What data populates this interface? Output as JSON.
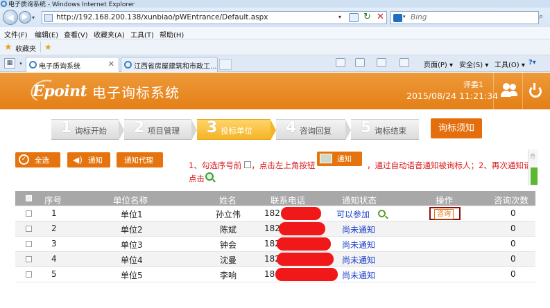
{
  "browser": {
    "window_title": "电子质询系统 - Windows Internet Explorer",
    "url": "http://192.168.200.138/xunbiao/pWEntrance/Default.aspx",
    "search_placeholder": "Bing",
    "menu": [
      "文件(F)",
      "编辑(E)",
      "查看(V)",
      "收藏夹(A)",
      "工具(T)",
      "帮助(H)"
    ],
    "favorites_label": "收藏夹",
    "tabs": [
      {
        "title": "电子质询系统",
        "active": true
      },
      {
        "title": "江西省房屋建筑和市政工...",
        "active": false
      }
    ],
    "command_bar": [
      "页面(P) ▾",
      "安全(S) ▾",
      "工具(O) ▾"
    ]
  },
  "app": {
    "logo": "Epoint",
    "title": "电子询标系统",
    "user": "评委1",
    "datetime": "2015/08/24 11:21:34",
    "accent_color": "#e5740f"
  },
  "steps": [
    {
      "num": "1",
      "label": "询标开始",
      "active": false
    },
    {
      "num": "2",
      "label": "项目管理",
      "active": false
    },
    {
      "num": "3",
      "label": "投标单位",
      "active": true
    },
    {
      "num": "4",
      "label": "咨询回复",
      "active": false
    },
    {
      "num": "5",
      "label": "询标结束",
      "active": false
    }
  ],
  "notice_button": "询标须知",
  "toolbar": {
    "select_all": "全选",
    "notify": "通知",
    "notify_agent": "通知代理"
  },
  "instruction": {
    "part1": "1、勾选序号前",
    "part2": "，点击左上角按钮",
    "button": "通知",
    "part3": "，通过自动语音通知被询标人；2、再次通知请",
    "line2": "点击"
  },
  "table": {
    "headers": [
      "序号",
      "单位名称",
      "姓名",
      "联系电话",
      "通知状态",
      "操作",
      "咨询次数"
    ],
    "rows": [
      {
        "no": "1",
        "unit": "单位1",
        "name": "孙立伟",
        "phone": "182",
        "status": "可以参加",
        "action": "咨询",
        "count": "0"
      },
      {
        "no": "2",
        "unit": "单位2",
        "name": "陈斌",
        "phone": "182",
        "status": "尚未通知",
        "action": "",
        "count": "0"
      },
      {
        "no": "3",
        "unit": "单位3",
        "name": "钟会",
        "phone": "182",
        "status": "尚未通知",
        "action": "",
        "count": "0"
      },
      {
        "no": "4",
        "unit": "单位4",
        "name": "沈曼",
        "phone": "182",
        "status": "尚未通知",
        "action": "",
        "count": "0"
      },
      {
        "no": "5",
        "unit": "单位5",
        "name": "李响",
        "phone": "18",
        "status": "尚未通知",
        "action": "",
        "count": "0"
      }
    ]
  }
}
